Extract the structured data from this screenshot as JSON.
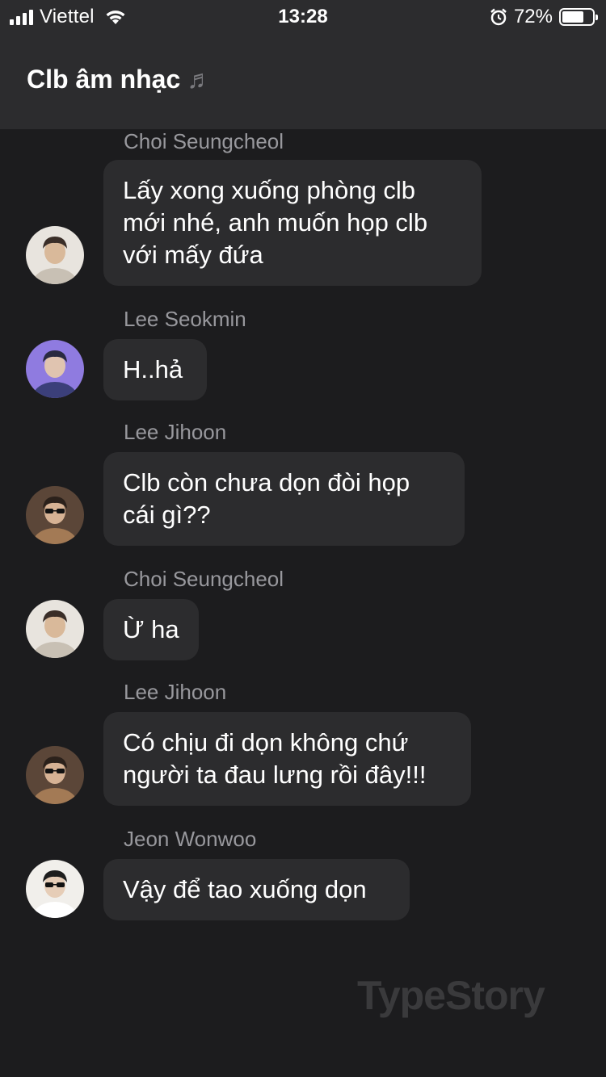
{
  "status_bar": {
    "carrier": "Viettel",
    "time": "13:28",
    "battery_percent": "72%",
    "battery_level": 0.72,
    "alarm_icon": "alarm-icon",
    "wifi_icon": "wifi-icon"
  },
  "header": {
    "title": "Clb âm nhạc",
    "title_icon": "music-notes-icon"
  },
  "messages": [
    {
      "sender": "Choi Seungcheol",
      "lines": [
        "Lấy xong xuống phòng clb",
        "mới nhé, anh muốn họp clb",
        "với mấy đứa"
      ],
      "avatar": "seungcheol"
    },
    {
      "sender": "Lee Seokmin",
      "lines": [
        "H..hả"
      ],
      "avatar": "seokmin"
    },
    {
      "sender": "Lee Jihoon",
      "lines": [
        "Clb còn chưa dọn đòi họp",
        "cái gì??"
      ],
      "avatar": "jihoon"
    },
    {
      "sender": "Choi Seungcheol",
      "lines": [
        "Ừ ha"
      ],
      "avatar": "seungcheol"
    },
    {
      "sender": "Lee Jihoon",
      "lines": [
        "Có chịu đi dọn không chứ",
        "người ta đau lưng rồi đây!!!"
      ],
      "avatar": "jihoon"
    },
    {
      "sender": "Jeon Wonwoo",
      "lines": [
        "Vậy để tao xuống dọn"
      ],
      "avatar": "wonwoo"
    }
  ],
  "watermark": "TypeStory",
  "colors": {
    "background": "#1c1c1e",
    "header": "#2c2c2e",
    "bubble": "#2c2c2e",
    "sender_name": "#98989d",
    "watermark": "#3a3a3c"
  }
}
